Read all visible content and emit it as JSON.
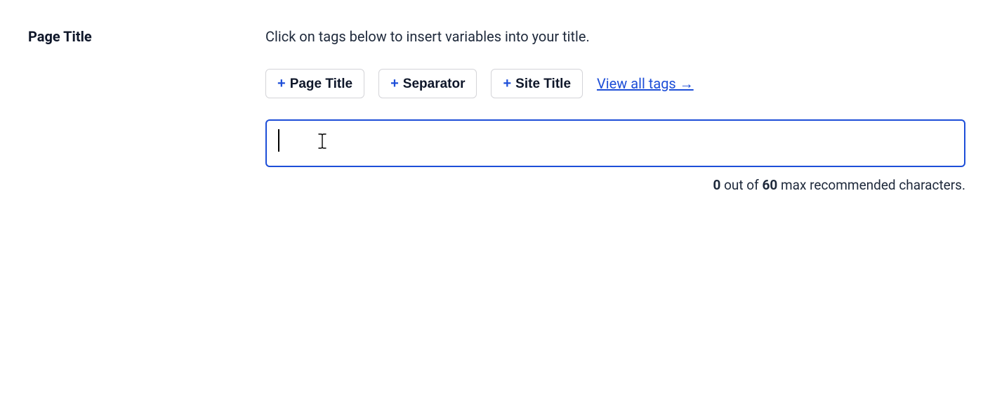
{
  "label": {
    "heading": "Page Title"
  },
  "content": {
    "hint": "Click on tags below to insert variables into your title.",
    "tags": [
      {
        "label": "Page Title"
      },
      {
        "label": "Separator"
      },
      {
        "label": "Site Title"
      }
    ],
    "view_all": "View all tags →",
    "input": {
      "value": "",
      "placeholder": ""
    },
    "counter": {
      "current": "0",
      "mid_text_1": " out of ",
      "max": "60",
      "mid_text_2": " max recommended characters."
    }
  }
}
